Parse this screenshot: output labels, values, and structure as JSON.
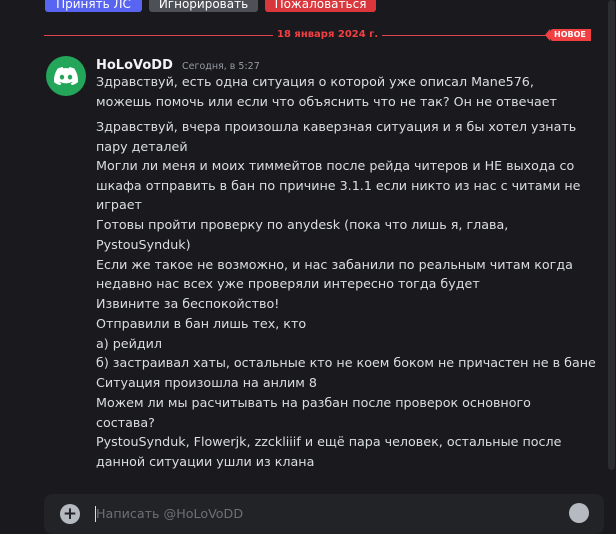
{
  "actions": {
    "accept_dm": "Принять ЛС",
    "ignore": "Игнорировать",
    "report": "Пожаловаться"
  },
  "divider": {
    "date": "18 января 2024 г.",
    "new_badge": "НОВОЕ"
  },
  "message": {
    "author": "HoLoVoDD",
    "timestamp": "Сегодня, в 5:27",
    "lines": [
      "Здравствуй, есть одна ситуация о которой уже описал Mane576,",
      "можешь помочь или если что объяснить что не так? Он не отвечает",
      "Здравствуй, вчера произошла каверзная ситуация и я бы хотел узнать",
      "пару деталей",
      "Могли ли меня и моих тиммейтов после рейда читеров и НЕ выхода со",
      "шкафа отправить в бан по причине 3.1.1 если никто из нас с читами не",
      "играет",
      "Готовы пройти проверку по anydesk (пока что лишь я, глава,",
      "PystouSynduk)",
      "Если же такое не возможно, и нас забанили по реальным читам когда",
      "недавно нас всех уже проверяли интересно тогда будет",
      "Извините за беспокойство!",
      "Отправили в бан лишь тех, кто",
      "а) рейдил",
      "б) застраивал хаты, остальные кто не коем боком не причастен не в бане",
      "Ситуация произошла на анлим 8",
      "Можем ли мы расчитывать на разбан после проверок основного",
      "состава?",
      "PystouSynduk, Flowerjk, zzckliiif и ещё пара человек, остальные после",
      "данной ситуации ушли из клана"
    ]
  },
  "composer": {
    "placeholder": "Написать @HoLoVoDD"
  },
  "colors": {
    "accent": "#5865f2",
    "danger": "#da373c",
    "secondary": "#4e5058",
    "avatar_bg": "#23a55a"
  }
}
